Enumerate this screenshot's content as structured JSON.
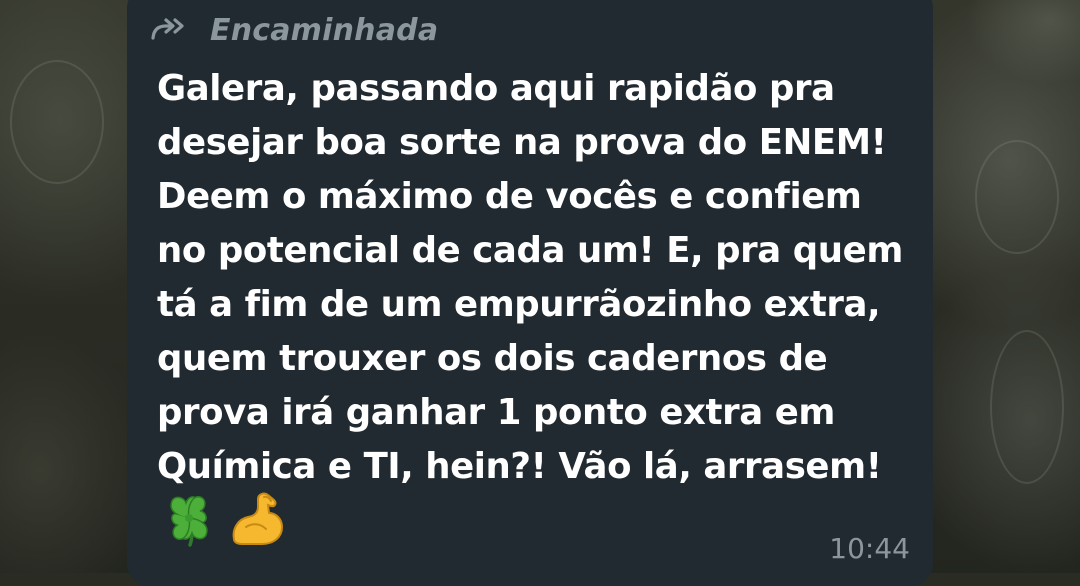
{
  "message": {
    "forward_label": "Encaminhada",
    "text": "Galera, passando aqui rapidão pra\ndesejar boa sorte na prova do ENEM!\nDeem o máximo de vocês e confiem\nno potencial de cada um! E, pra quem\ntá a fim de um empurrãozinho extra,\nquem trouxer os dois cadernos de\nprova irá ganhar 1 ponto extra em\nQuímica e TI, hein?! Vão lá, arrasem!",
    "emojis": [
      "four-leaf-clover-emoji",
      "flexed-biceps-emoji"
    ],
    "time": "10:44"
  },
  "colors": {
    "bubble": "#202a30",
    "text": "#ffffff",
    "meta": "#8b969d"
  }
}
